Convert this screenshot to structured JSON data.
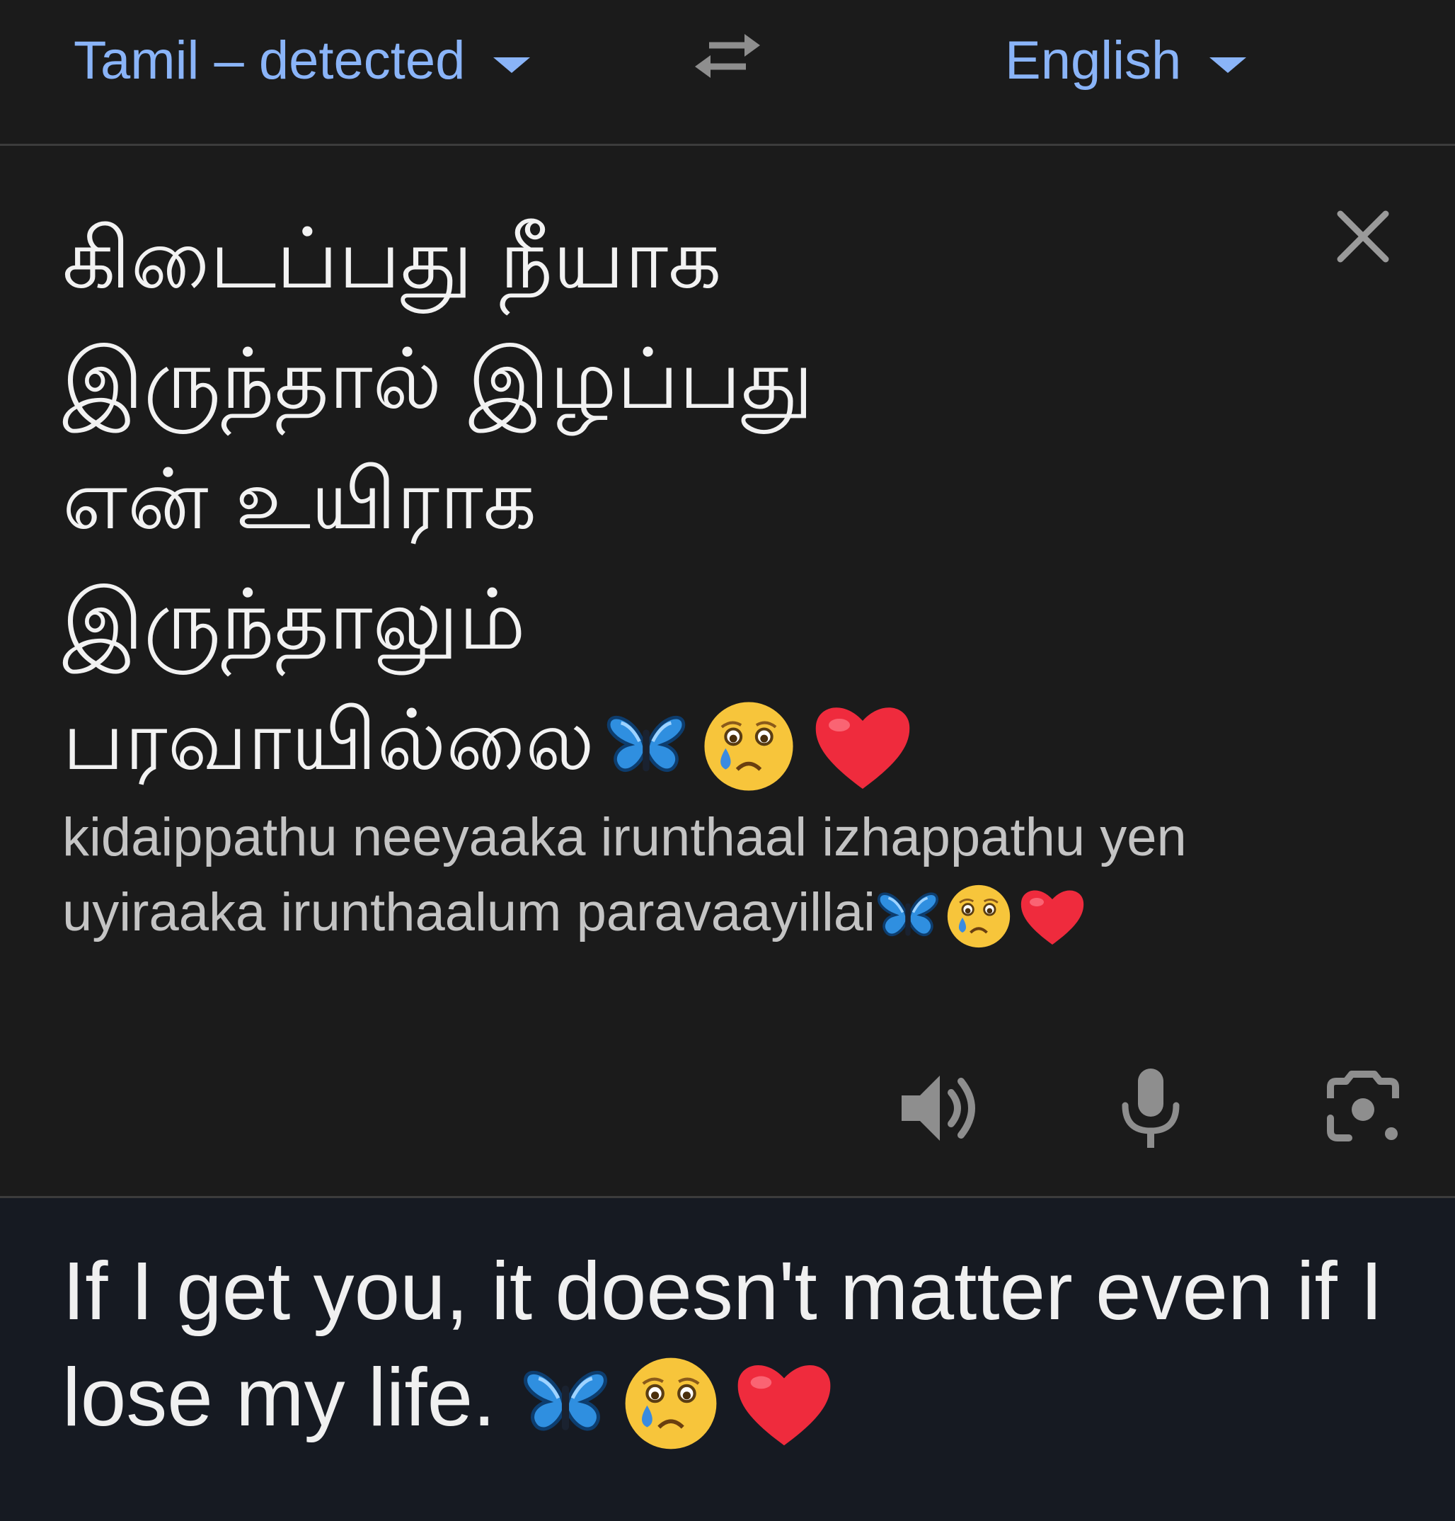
{
  "language_bar": {
    "source_language": "Tamil – detected",
    "target_language": "English",
    "swap_icon": "swap-arrows-icon"
  },
  "source": {
    "text": "கிடைப்பது நீயாக\nஇருந்தால் இழப்பது\nஎன் உயிராக\nஇருந்தாலும்\nபரவாயில்லை",
    "transliteration": "kidaippathu neeyaaka irunthaal izhappathu yen uyiraaka irunthaalum paravaayillai",
    "emojis": [
      "butterfly-emoji",
      "crying-face-emoji",
      "red-heart-emoji"
    ],
    "icons": {
      "close": "close-icon",
      "speaker": "speaker-icon",
      "mic": "microphone-icon",
      "camera": "camera-icon"
    }
  },
  "result": {
    "text": "If I get you, it doesn't matter even if I lose my life."
  },
  "colors": {
    "background": "#1b1b1b",
    "accent": "#8ab4f8",
    "result_background": "#161a22",
    "icon_gray": "#8e8e8e"
  }
}
